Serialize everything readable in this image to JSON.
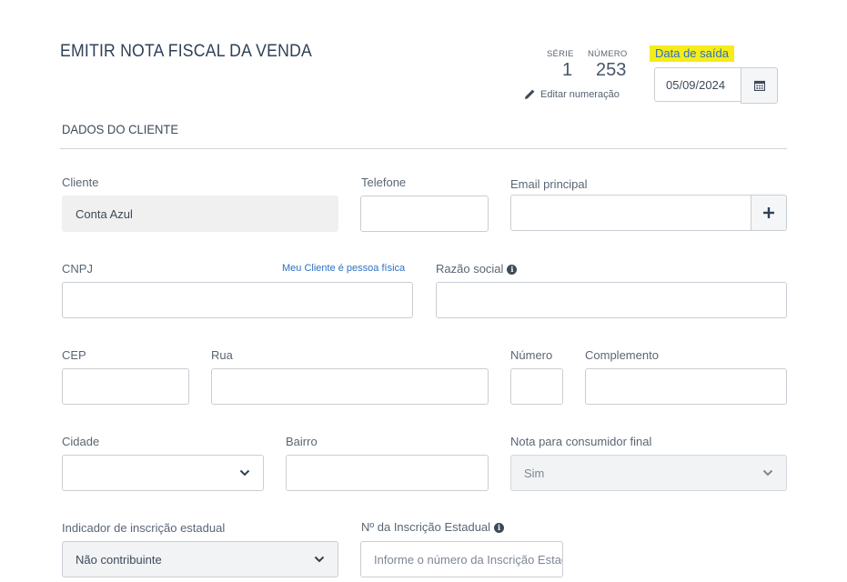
{
  "header": {
    "title": "EMITIR NOTA FISCAL DA VENDA",
    "serie_label": "SÉRIE",
    "serie_value": "1",
    "numero_label": "NÚMERO",
    "numero_value": "253",
    "edit_numbering": "Editar numeração",
    "date_label": "Data de saída",
    "date_value": "05/09/2024",
    "date_icon": "calendar-icon"
  },
  "section": {
    "title": "DADOS DO CLIENTE"
  },
  "form": {
    "cliente": {
      "label": "Cliente",
      "value": "Conta Azul"
    },
    "telefone": {
      "label": "Telefone",
      "value": ""
    },
    "email": {
      "label": "Email principal",
      "value": "",
      "add_icon": "plus-icon"
    },
    "cnpj": {
      "label": "CNPJ",
      "value": "",
      "link": "Meu Cliente é pessoa física"
    },
    "razao_social": {
      "label": "Razão social",
      "value": "",
      "info_icon": "info-icon"
    },
    "cep": {
      "label": "CEP",
      "value": ""
    },
    "rua": {
      "label": "Rua",
      "value": ""
    },
    "numero": {
      "label": "Número",
      "value": ""
    },
    "complemento": {
      "label": "Complemento",
      "value": ""
    },
    "cidade": {
      "label": "Cidade",
      "value": ""
    },
    "bairro": {
      "label": "Bairro",
      "value": ""
    },
    "consumidor_final": {
      "label": "Nota para consumidor final",
      "value": "Sim"
    },
    "indicador_ie": {
      "label": "Indicador de inscrição estadual",
      "value": "Não contribuinte"
    },
    "inscricao_estadual": {
      "label": "Nº da Inscrição Estadual",
      "placeholder": "Informe o número da Inscrição Estadual",
      "info_icon": "info-icon"
    }
  },
  "colors": {
    "accent_link": "#2f6fc4",
    "highlight": "#f5ec1a",
    "text": "#3d4a58",
    "border": "#c9ced4"
  }
}
